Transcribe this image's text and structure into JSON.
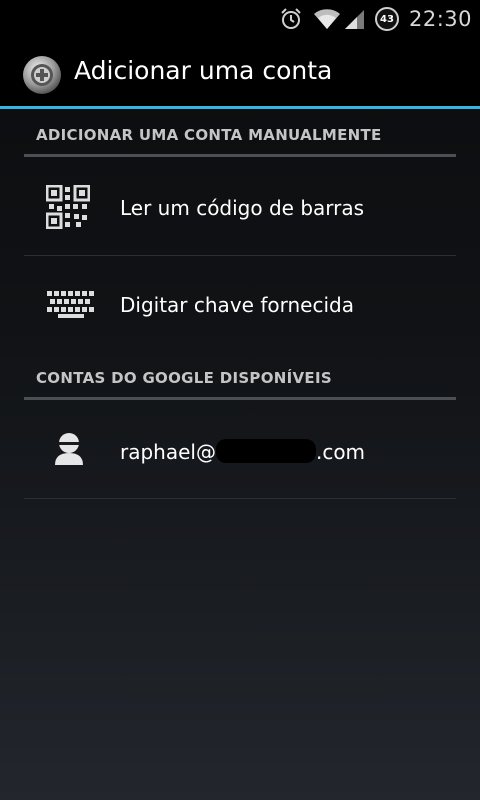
{
  "status_bar": {
    "time": "22:30",
    "battery_level": "43",
    "icons": [
      "alarm-icon",
      "wifi-icon",
      "cell-signal-icon",
      "battery-icon"
    ]
  },
  "action_bar": {
    "title": "Adicionar uma conta",
    "app_icon": "authenticator-app-icon",
    "accent_color": "#33b5e5"
  },
  "sections": [
    {
      "header": "ADICIONAR UMA CONTA MANUALMENTE",
      "items": [
        {
          "label": "Ler um código de barras",
          "icon": "qr-code-icon"
        },
        {
          "label": "Digitar chave fornecida",
          "icon": "keyboard-icon"
        }
      ]
    },
    {
      "header": "CONTAS DO GOOGLE DISPONÍVEIS",
      "items": [
        {
          "email_prefix": "raphael@",
          "email_suffix": ".com",
          "icon": "account-icon"
        }
      ]
    }
  ]
}
